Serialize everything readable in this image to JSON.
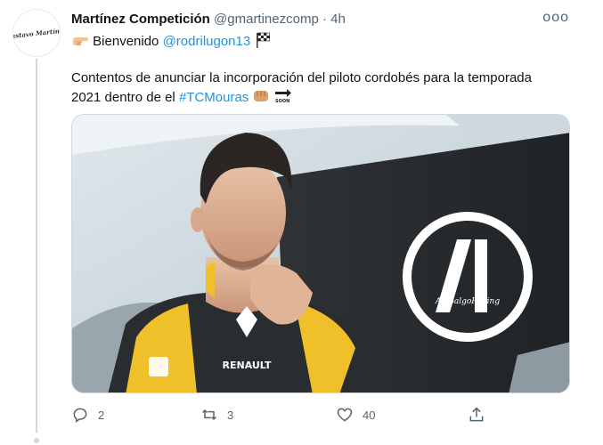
{
  "tweet": {
    "display_name": "Martínez Competición",
    "handle": "@gmartinezcomp",
    "separator": "·",
    "time": "4h",
    "more_label": "ooo",
    "avatar_text": "Gustavo Martínez",
    "line1_prefix": "Bienvenido",
    "mention": "@rodrilugon13",
    "body_text": "Contentos de anunciar la incorporación del piloto cordobés para la temporada 2021 dentro de el",
    "hashtag": "#TCMouras",
    "image_texts": {
      "suit_brand": "RENAULT",
      "logo_text": "AnibalgoRacing"
    },
    "icons": {
      "pointing_hand": "backhand-index-pointing-right-emoji",
      "flag": "chequered-flag-emoji",
      "fist": "oncoming-fist-emoji",
      "soon": "soon-arrow-emoji"
    },
    "actions": {
      "reply_count": "2",
      "retweet_count": "3",
      "like_count": "40",
      "share_count": ""
    }
  }
}
